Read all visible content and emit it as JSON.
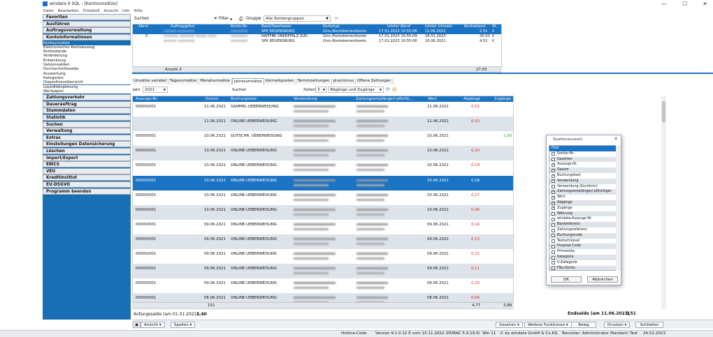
{
  "window": {
    "title": "windata 9 SQL - [Kontoumsätze]",
    "controls": [
      "—",
      "☐",
      "✕"
    ]
  },
  "menu": [
    "Datei",
    "Bearbeiten",
    "Protokoll",
    "Ansicht",
    "Info",
    "Hilfe"
  ],
  "sidebar": {
    "top_heads": [
      "Favoriten",
      "Ausführen",
      "Auftragsverwaltung",
      "Kontoinformationen"
    ],
    "sub_items": [
      "Kontoumsätze",
      "Elektronischer Kontoauszug",
      "Kontostände",
      "Veränderung",
      "Entwicklung",
      "Valutensalden",
      "Durchschnittssaldo",
      "Auswertung",
      "Kategorien",
      "Dispositionsübersicht",
      "Liquiditätsplanung",
      "Wertpapier"
    ],
    "bottom_heads": [
      "Zahlungsverkehr",
      "Dauerauftrag",
      "Stammdaten",
      "Statistik",
      "Suchen",
      "Verwaltung",
      "Extras",
      "Einstellungen Datensicherung",
      "Löschen",
      "Import/Export",
      "EBICS",
      "VEU",
      "Kreditinstitut",
      "EU-DSGVO",
      "Programm beenden"
    ]
  },
  "accounts": {
    "search_label": "Suchen",
    "filter_label": "Filter",
    "group_label": "Gruppe",
    "group_value": "Alle Kontengruppen",
    "columns": [
      "Abruf",
      "Auftraggeber",
      "Konto-Nr.",
      "Bank/Sparkasse",
      "Kontotyp",
      "letzter Abruf",
      "letzter Umsatz",
      "Kontostand",
      "W..."
    ],
    "rows": [
      {
        "abruf": "",
        "auftraggeber": "xxxxxx xxxxxxxx",
        "konto": "xxxxxxxx",
        "bank": "SPK REGENSBURG",
        "typ": "Giro-/Kontokorrentkonto",
        "abruf_date": "17.01.2023 10:55:06",
        "umsatz": "11.06.2021",
        "stand": "2,51",
        "w": "€"
      },
      {
        "abruf": "5",
        "auftraggeber": "xxxxxxx xxxxxxx xxxxx xxxx",
        "konto": "xxxxxxxx",
        "bank": "RAIFFBK OBERPFALZ SÜD",
        "typ": "Giro-/Kontokorrentkonto",
        "abruf_date": "17.01.2023 10:55:09",
        "umsatz": "16.01.2023",
        "stand": "20,03",
        "w": "€"
      },
      {
        "abruf": "",
        "auftraggeber": "xxxxxx xxxxxxxx",
        "konto": "xxxxxxxx",
        "bank": "SPK REGENSBURG",
        "typ": "Giro-/Kontokorrentkonto",
        "abruf_date": "17.01.2023 10:55:06",
        "umsatz": "10.06.2021",
        "stand": "4,51",
        "w": "€"
      }
    ],
    "footer_count": "Anzahl 3",
    "footer_total": "27,05"
  },
  "tabs": [
    "Umsätze variabel",
    "Tagesumsätze",
    "Monatsumsätze",
    "Jahresumsätze",
    "Vormerkposten",
    "Terminzahlungen",
    "plus/minus",
    "Offene Zahlungen"
  ],
  "controls": {
    "jahr_label": "Jahr",
    "jahr_value": "2021",
    "suchen_label": "Suchen",
    "zeilen_label": "Zeilen",
    "zeilen_value": "3",
    "art_value": "Abgänge und Zugänge"
  },
  "transactions": {
    "columns": [
      "Auszugs-Nr.",
      "Datum",
      "Buchungstext",
      "Verwendung",
      "Zahlungsempfänger/-pflichti...",
      "Wert",
      "Abgänge",
      "Zugänge"
    ],
    "rows": [
      {
        "nr": "00000/001",
        "datum": "11.06.2021",
        "text": "SAMMEL-UEBERWEISUNG",
        "wert": "11.06.2021",
        "ab": "0,01",
        "zu": ""
      },
      {
        "nr": "",
        "datum": "11.06.2021",
        "text": "ONLINE-UEBERWEISUNG",
        "wert": "11.06.2021",
        "ab": "0,23",
        "zu": ""
      },
      {
        "nr": "00000/001",
        "datum": "10.06.2021",
        "text": "GUTSCHR. UEBERWEISUNG",
        "wert": "10.06.2021",
        "ab": "",
        "zu": "1,00"
      },
      {
        "nr": "00000/001",
        "datum": "10.06.2021",
        "text": "ONLINE-UEBERWEISUNG",
        "wert": "10.06.2021",
        "ab": "0,20",
        "zu": ""
      },
      {
        "nr": "00000/001",
        "datum": "10.06.2021",
        "text": "ONLINE-UEBERWEISUNG",
        "wert": "10.06.2021",
        "ab": "0,19",
        "zu": ""
      },
      {
        "nr": "00000/001",
        "datum": "10.06.2021",
        "text": "ONLINE-UEBERWEISUNG",
        "wert": "10.06.2021",
        "ab": "0,18",
        "zu": ""
      },
      {
        "nr": "00000/001",
        "datum": "10.06.2021",
        "text": "ONLINE-UEBERWEISUNG",
        "wert": "10.06.2021",
        "ab": "0,17",
        "zu": ""
      },
      {
        "nr": "00000/001",
        "datum": "10.06.2021",
        "text": "ONLINE-UEBERWEISUNG",
        "wert": "10.06.2021",
        "ab": "0,06",
        "zu": ""
      },
      {
        "nr": "00000/001",
        "datum": "09.06.2021",
        "text": "ONLINE-UEBERWEISUNG",
        "wert": "09.06.2021",
        "ab": "0,14",
        "zu": ""
      },
      {
        "nr": "00000/001",
        "datum": "09.06.2021",
        "text": "ONLINE-UEBERWEISUNG",
        "wert": "09.06.2021",
        "ab": "0,13",
        "zu": ""
      },
      {
        "nr": "00000/001",
        "datum": "09.06.2021",
        "text": "ONLINE-UEBERWEISUNG",
        "wert": "09.06.2021",
        "ab": "0,12",
        "zu": ""
      },
      {
        "nr": "00000/001",
        "datum": "09.06.2021",
        "text": "ONLINE-UEBERWEISUNG",
        "wert": "09.06.2021",
        "ab": "0,11",
        "zu": ""
      },
      {
        "nr": "00000/001",
        "datum": "09.06.2021",
        "text": "ONLINE-UEBERWEISUNG",
        "wert": "09.06.2021",
        "ab": "0,10",
        "zu": ""
      },
      {
        "nr": "00000/001",
        "datum": "08.06.2021",
        "text": "ONLINE-UEBERWEISUNG",
        "wert": "08.06.2021",
        "ab": "0,09",
        "zu": ""
      }
    ],
    "footer_count": "151",
    "footer_ab": "4,77",
    "footer_zu": "3,88"
  },
  "balances": {
    "anfang_label": "Anfangssaldo (am 01.01.2021)",
    "anfang_value": "3,40",
    "end_label": "Endsaldo (am 11.06.2021)",
    "end_value": "2,51"
  },
  "toolbar": {
    "ansicht": "Ansicht",
    "spalten": "Spalten",
    "gesehen": "Gesehen",
    "weitere": "Weitere Funktionen",
    "beleg": "Beleg",
    "drucken": "Drucken",
    "schliessen": "Schließen"
  },
  "status": {
    "hotline": "Hotline-Code",
    "version": "Version 9.1.0.12 E vom 15.11.2022 (DDBAC 5.9.19.0)",
    "os": "Win 11",
    "copyright": "© by windata GmbH & Co.KG",
    "user": "Benutzer: Administrator",
    "mandant": "Mandant: Test",
    "date": "24.01.2023"
  },
  "chooser": {
    "title": "Spaltenauswahl",
    "header": "Feld",
    "items": [
      {
        "label": "Sortier-Nr.",
        "checked": false
      },
      {
        "label": "Gesehen",
        "checked": false
      },
      {
        "label": "Auszugs-Nr.",
        "checked": true
      },
      {
        "label": "Datum",
        "checked": true
      },
      {
        "label": "Buchungstext",
        "checked": true
      },
      {
        "label": "Verwendung",
        "checked": true
      },
      {
        "label": "Verwendung (Kurzform)",
        "checked": false
      },
      {
        "label": "Zahlungsempfänger/-pflichtiger",
        "checked": true
      },
      {
        "label": "Wert",
        "checked": true
      },
      {
        "label": "Abgänge",
        "checked": true
      },
      {
        "label": "Zugänge",
        "checked": true
      },
      {
        "label": "Währung",
        "checked": false
      },
      {
        "label": "windata-Auszugs-Nr.",
        "checked": false
      },
      {
        "label": "Bankreferenz",
        "checked": false
      },
      {
        "label": "Zahlungsreferenz",
        "checked": false
      },
      {
        "label": "Buchungscode",
        "checked": false
      },
      {
        "label": "Textschlüssel",
        "checked": false
      },
      {
        "label": "Purpose Code",
        "checked": false
      },
      {
        "label": "Primanota",
        "checked": false
      },
      {
        "label": "Kategorie",
        "checked": false
      },
      {
        "label": "U-Kategorie",
        "checked": false
      },
      {
        "label": "Fibu-Konto",
        "checked": false
      }
    ],
    "ok": "OK",
    "cancel": "Abbrechen"
  },
  "colors": {
    "accent": "#1b73c4",
    "negative": "#d22222",
    "positive": "#1a9c1a",
    "alt_row": "#dde3e9"
  }
}
